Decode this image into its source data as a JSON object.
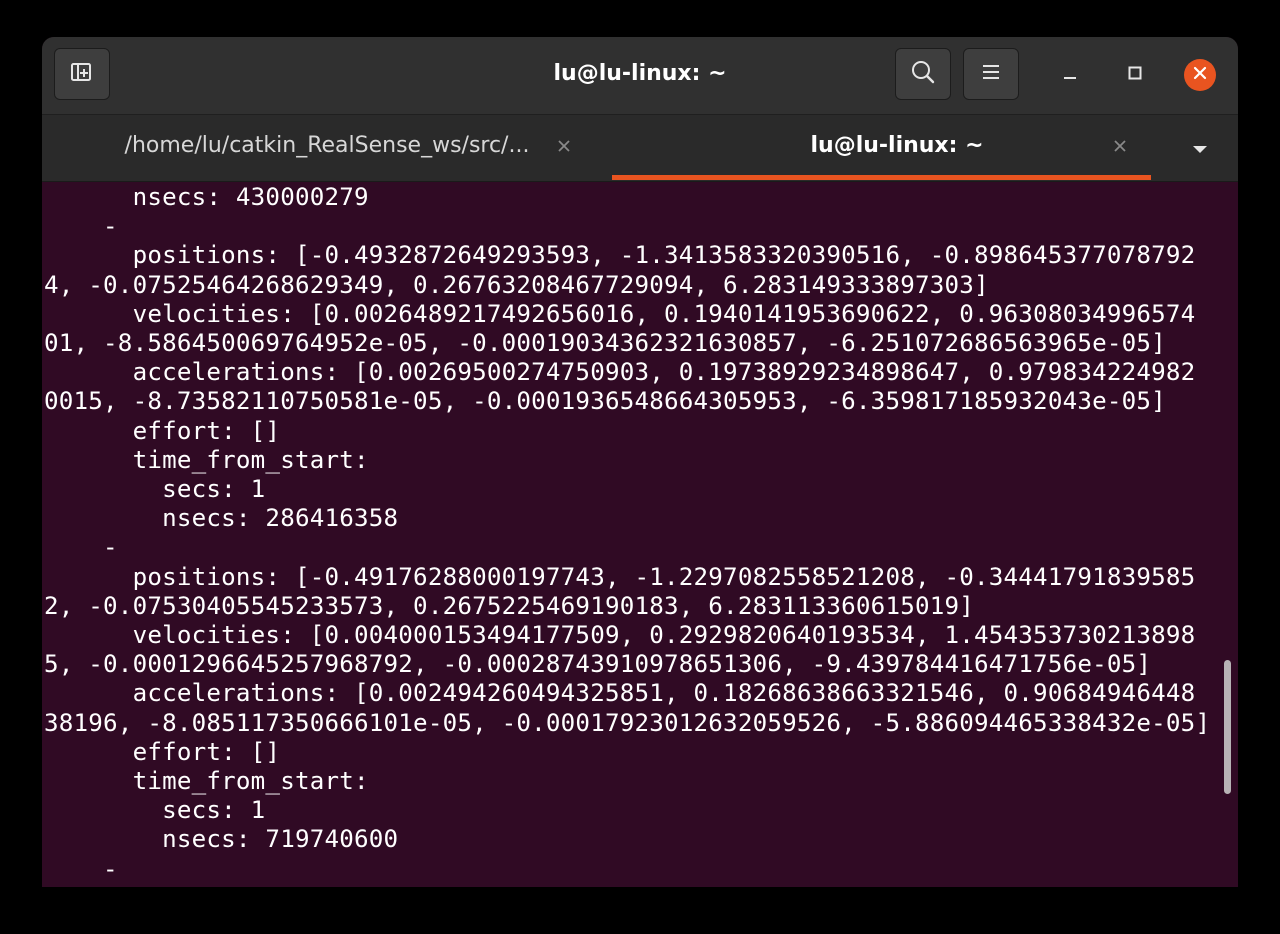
{
  "window": {
    "title": "lu@lu-linux: ~"
  },
  "header": {
    "new_tab_icon": "new-tab-icon",
    "search_icon": "search-icon",
    "menu_icon": "hamburger-menu-icon",
    "minimize_icon": "minimize-icon",
    "maximize_icon": "maximize-icon",
    "close_icon": "close-icon"
  },
  "tabs": [
    {
      "label": "/home/lu/catkin_RealSense_ws/src/...",
      "active": false
    },
    {
      "label": "lu@lu-linux: ~",
      "active": true
    }
  ],
  "colors": {
    "terminal_bg": "#300a24",
    "accent": "#e95420",
    "headerbar": "#303030",
    "tabbar": "#2a2a2a"
  },
  "terminal": {
    "lines": [
      "      nsecs: 430000279",
      "    -",
      "      positions: [-0.4932872649293593, -1.3413583320390516, -0.898645377078792",
      "4, -0.07525464268629349, 0.26763208467729094, 6.283149333897303]",
      "      velocities: [0.002648921749265601​6, 0.194014195369062​2, 0.96308034996574",
      "01, -8.586450069764952e-05, -0.00019034362321630857, -6.251072686563965e-05]",
      "      accelerations: [0.00269500274750903, 0.19738929234898647, 0.979834224982",
      "0015, -8.73582110750581e-05, -0.0001936548664305953, -6.359817185932043e-05]",
      "      effort: []",
      "      time_from_start:",
      "        secs: 1",
      "        nsecs: 286416358",
      "    -",
      "      positions: [-0.49176288000197743, -1.2297082558521208, -0.34441791839585",
      "2, -0.07530405545233573, 0.267522546919018​3, 6.283113360615019]",
      "      velocities: [0.004000153494177509, 0.2929820640193534, 1.454353730213898",
      "5, -0.0001296645257968792, -0.00028743910978651306, -9.439784416471756e-05]",
      "      accelerations: [0.00249426049432585​1, 0.18268638663321546, 0.90684946448",
      "38196, -8.085117350666101e-05, -0.00017923012632059526, -5.886094465338432e-05]",
      "      effort: []",
      "      time_from_start:",
      "        secs: 1",
      "        nsecs: 719740600",
      "    -"
    ]
  }
}
